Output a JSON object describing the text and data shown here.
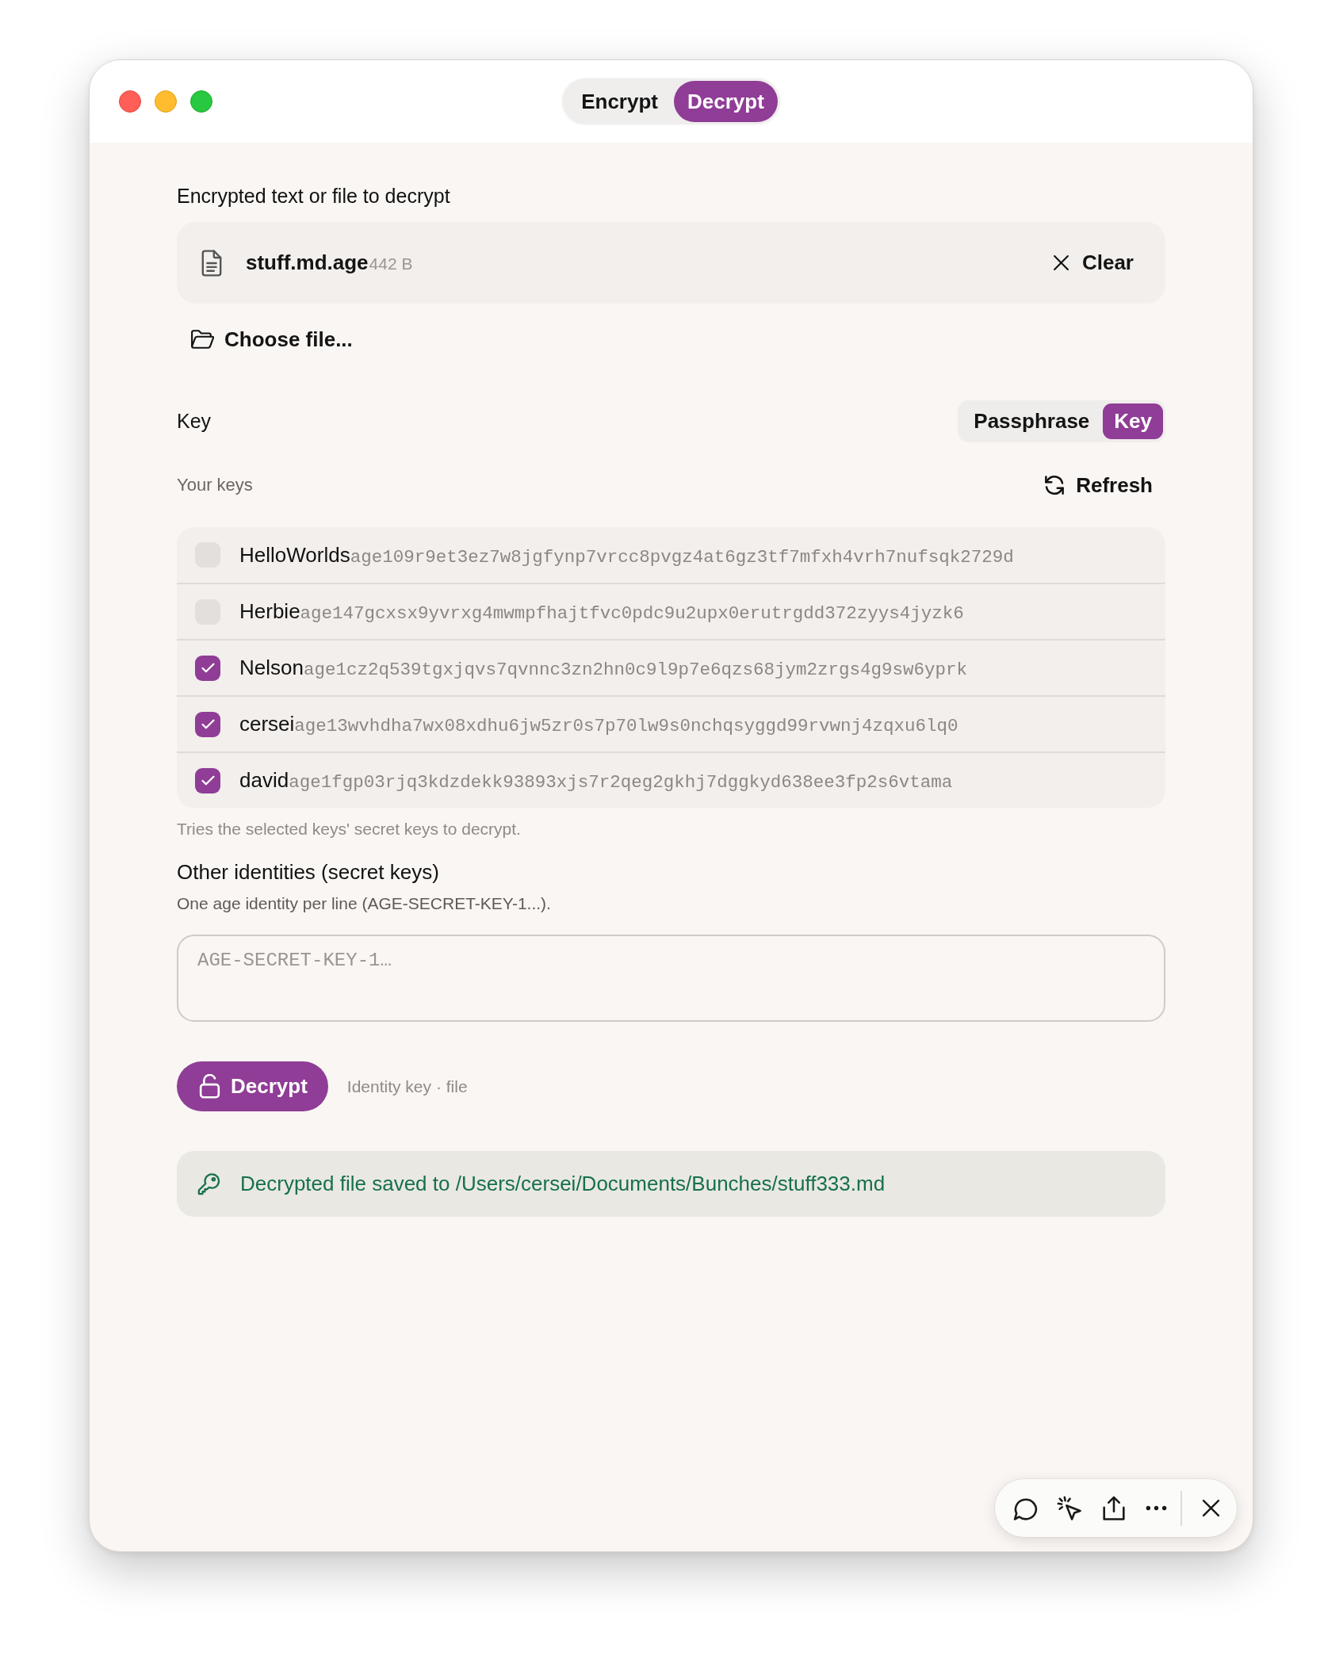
{
  "window": {
    "mode_tabs": [
      {
        "label": "Encrypt",
        "selected": false
      },
      {
        "label": "Decrypt",
        "selected": true
      }
    ]
  },
  "source": {
    "label": "Encrypted text or file to decrypt",
    "file_name": "stuff.md.age",
    "file_size": "442 B",
    "clear_button": "Clear",
    "choose_button": "Choose file..."
  },
  "key": {
    "label": "Key",
    "method_tabs": [
      {
        "label": "Passphrase",
        "selected": false
      },
      {
        "label": "Key",
        "selected": true
      }
    ],
    "your_keys_label": "Your keys",
    "refresh_button": "Refresh",
    "keys": [
      {
        "name": "HelloWorlds",
        "key": "age109r9et3ez7w8jgfynp7vrcc8pvgz4at6gz3tf7mfxh4vrh7nufsqk2729d",
        "checked": false
      },
      {
        "name": "Herbie",
        "key": "age147gcxsx9yvrxg4mwmpfhajtfvc0pdc9u2upx0erutrgdd372zyys4jyzk6",
        "checked": false
      },
      {
        "name": "Nelson",
        "key": "age1cz2q539tgxjqvs7qvnnc3zn2hn0c9l9p7e6qzs68jym2zrgs4g9sw6yprk",
        "checked": true
      },
      {
        "name": "cersei",
        "key": "age13wvhdha7wx08xdhu6jw5zr0s7p70lw9s0nchqsyggd99rvwnj4zqxu6lq0",
        "checked": true
      },
      {
        "name": "david",
        "key": "age1fgp03rjq3kdzdekk93893xjs7r2qeg2gkhj7dggkyd638ee3fp2s6vtama",
        "checked": true
      }
    ],
    "hint": "Tries the selected keys' secret keys to decrypt."
  },
  "other_identities": {
    "label": "Other identities (secret keys)",
    "hint": "One age identity per line (AGE-SECRET-KEY-1...).",
    "placeholder": "AGE-SECRET-KEY-1…"
  },
  "action": {
    "button": "Decrypt",
    "summary": "Identity key · file"
  },
  "result": {
    "message": "Decrypted file saved to /Users/cersei/Documents/Bunches/stuff333.md"
  }
}
